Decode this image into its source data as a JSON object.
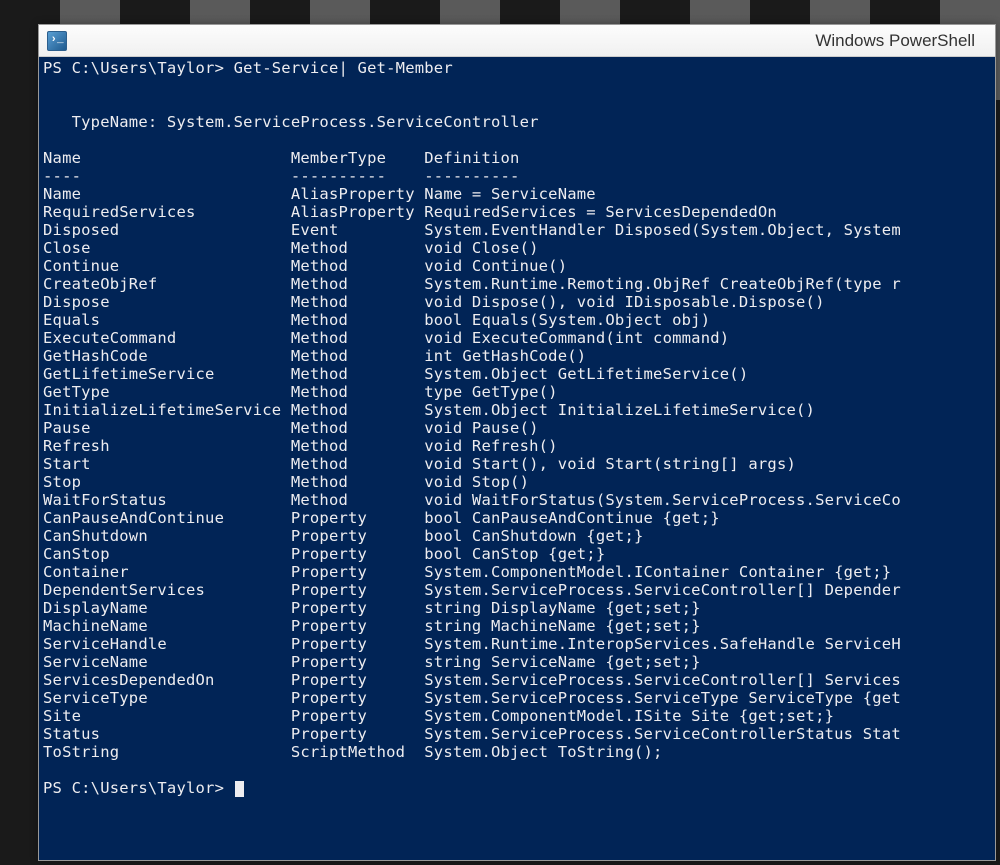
{
  "window": {
    "title": "Windows PowerShell"
  },
  "terminal": {
    "prompt1": "PS C:\\Users\\Taylor> Get-Service| Get-Member",
    "blank": "",
    "typename": "   TypeName: System.ServiceProcess.ServiceController",
    "columns": {
      "name": "Name",
      "membertype": "MemberType",
      "definition": "Definition",
      "name_div": "----",
      "membertype_div": "----------",
      "definition_div": "----------"
    },
    "members": [
      {
        "name": "Name",
        "type": "AliasProperty",
        "def": "Name = ServiceName"
      },
      {
        "name": "RequiredServices",
        "type": "AliasProperty",
        "def": "RequiredServices = ServicesDependedOn"
      },
      {
        "name": "Disposed",
        "type": "Event",
        "def": "System.EventHandler Disposed(System.Object, System"
      },
      {
        "name": "Close",
        "type": "Method",
        "def": "void Close()"
      },
      {
        "name": "Continue",
        "type": "Method",
        "def": "void Continue()"
      },
      {
        "name": "CreateObjRef",
        "type": "Method",
        "def": "System.Runtime.Remoting.ObjRef CreateObjRef(type r"
      },
      {
        "name": "Dispose",
        "type": "Method",
        "def": "void Dispose(), void IDisposable.Dispose()"
      },
      {
        "name": "Equals",
        "type": "Method",
        "def": "bool Equals(System.Object obj)"
      },
      {
        "name": "ExecuteCommand",
        "type": "Method",
        "def": "void ExecuteCommand(int command)"
      },
      {
        "name": "GetHashCode",
        "type": "Method",
        "def": "int GetHashCode()"
      },
      {
        "name": "GetLifetimeService",
        "type": "Method",
        "def": "System.Object GetLifetimeService()"
      },
      {
        "name": "GetType",
        "type": "Method",
        "def": "type GetType()"
      },
      {
        "name": "InitializeLifetimeService",
        "type": "Method",
        "def": "System.Object InitializeLifetimeService()"
      },
      {
        "name": "Pause",
        "type": "Method",
        "def": "void Pause()"
      },
      {
        "name": "Refresh",
        "type": "Method",
        "def": "void Refresh()"
      },
      {
        "name": "Start",
        "type": "Method",
        "def": "void Start(), void Start(string[] args)"
      },
      {
        "name": "Stop",
        "type": "Method",
        "def": "void Stop()"
      },
      {
        "name": "WaitForStatus",
        "type": "Method",
        "def": "void WaitForStatus(System.ServiceProcess.ServiceCo"
      },
      {
        "name": "CanPauseAndContinue",
        "type": "Property",
        "def": "bool CanPauseAndContinue {get;}"
      },
      {
        "name": "CanShutdown",
        "type": "Property",
        "def": "bool CanShutdown {get;}"
      },
      {
        "name": "CanStop",
        "type": "Property",
        "def": "bool CanStop {get;}"
      },
      {
        "name": "Container",
        "type": "Property",
        "def": "System.ComponentModel.IContainer Container {get;}"
      },
      {
        "name": "DependentServices",
        "type": "Property",
        "def": "System.ServiceProcess.ServiceController[] Depender"
      },
      {
        "name": "DisplayName",
        "type": "Property",
        "def": "string DisplayName {get;set;}"
      },
      {
        "name": "MachineName",
        "type": "Property",
        "def": "string MachineName {get;set;}"
      },
      {
        "name": "ServiceHandle",
        "type": "Property",
        "def": "System.Runtime.InteropServices.SafeHandle ServiceH"
      },
      {
        "name": "ServiceName",
        "type": "Property",
        "def": "string ServiceName {get;set;}"
      },
      {
        "name": "ServicesDependedOn",
        "type": "Property",
        "def": "System.ServiceProcess.ServiceController[] Services"
      },
      {
        "name": "ServiceType",
        "type": "Property",
        "def": "System.ServiceProcess.ServiceType ServiceType {get"
      },
      {
        "name": "Site",
        "type": "Property",
        "def": "System.ComponentModel.ISite Site {get;set;}"
      },
      {
        "name": "Status",
        "type": "Property",
        "def": "System.ServiceProcess.ServiceControllerStatus Stat"
      },
      {
        "name": "ToString",
        "type": "ScriptMethod",
        "def": "System.Object ToString();"
      }
    ],
    "prompt2": "PS C:\\Users\\Taylor> "
  },
  "layout": {
    "col1_width": 26,
    "col2_width": 14
  }
}
